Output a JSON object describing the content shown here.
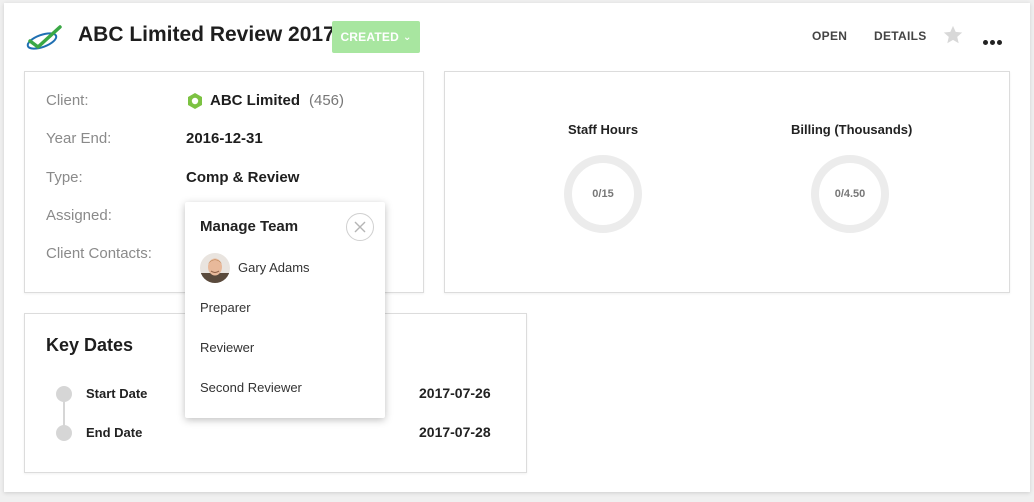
{
  "header": {
    "title": "ABC Limited Review 2017",
    "status_label": "CREATED",
    "links": [
      "OPEN",
      "DETAILS"
    ]
  },
  "info": {
    "client_label": "Client:",
    "client_name": "ABC Limited",
    "client_id": "(456)",
    "year_end_label": "Year End:",
    "year_end": "2016-12-31",
    "type_label": "Type:",
    "type": "Comp & Review",
    "assigned_label": "Assigned:",
    "contacts_label": "Client Contacts:"
  },
  "stats": {
    "staff_hours_label": "Staff Hours",
    "staff_hours_value": "0/15",
    "billing_label": "Billing (Thousands)",
    "billing_value": "0/4.50"
  },
  "key_dates": {
    "title": "Key Dates",
    "start_label": "Start Date",
    "start_value": "2017-07-26",
    "end_label": "End Date",
    "end_value": "2017-07-28"
  },
  "manage_team": {
    "title": "Manage Team",
    "member": "Gary Adams",
    "roles": [
      "Preparer",
      "Reviewer",
      "Second Reviewer"
    ]
  },
  "colors": {
    "status_green": "#a8e6a0",
    "client_hex_green": "#7cc242"
  }
}
